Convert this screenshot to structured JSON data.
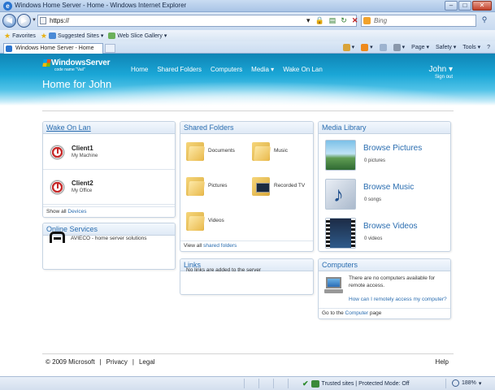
{
  "window": {
    "title": "Windows Home Server - Home - Windows Internet Explorer",
    "controls": [
      "–",
      "□",
      "✕"
    ]
  },
  "address_bar": {
    "url": "https://",
    "search_placeholder": "Bing"
  },
  "favorites_bar": {
    "favorites_label": "Favorites",
    "items": [
      "Suggested Sites ▾",
      "Web Slice Gallery ▾"
    ]
  },
  "tabs": [
    {
      "label": "Windows Home Server - Home"
    }
  ],
  "command_bar": {
    "page": "Page ▾",
    "safety": "Safety ▾",
    "tools": "Tools ▾",
    "help": "?"
  },
  "header": {
    "brand_name": "WindowsServer",
    "brand_code": "code name \"Vail\"",
    "page_title": "Home for John",
    "nav": [
      "Home",
      "Shared Folders",
      "Computers",
      "Media ▾",
      "Wake On Lan"
    ],
    "user_name": "John ▾",
    "sign_out": "Sign out"
  },
  "wake_on_lan": {
    "title": "Wake On Lan",
    "clients": [
      {
        "name": "Client1",
        "location": "My Machine"
      },
      {
        "name": "Client2",
        "location": "My Office"
      }
    ],
    "footer_prefix": "Show all ",
    "footer_link": "Devices"
  },
  "online_services": {
    "title": "Online Services",
    "text": "AVIECO - home server solutions"
  },
  "shared_folders": {
    "title": "Shared Folders",
    "folders": [
      "Documents",
      "Music",
      "Pictures",
      "Recorded TV",
      "Videos"
    ],
    "footer_prefix": "View all ",
    "footer_link": "shared folders"
  },
  "links": {
    "title": "Links",
    "text": "No links are added to the server"
  },
  "media_library": {
    "title": "Media Library",
    "items": [
      {
        "title": "Browse Pictures",
        "count": "0 pictures"
      },
      {
        "title": "Browse Music",
        "count": "0 songs"
      },
      {
        "title": "Browse Videos",
        "count": "0 videos"
      }
    ]
  },
  "computers": {
    "title": "Computers",
    "text": "There are no computers available for remote access.",
    "link": "How can I remotely access my computer?",
    "footer_prefix": "Go to the ",
    "footer_link": "Computer",
    "footer_suffix": " page"
  },
  "footer": {
    "copyright": "© 2009 Microsoft",
    "privacy": "Privacy",
    "legal": "Legal",
    "help": "Help"
  },
  "status_bar": {
    "zone": "Trusted sites | Protected Mode: Off",
    "zoom": "188%"
  }
}
